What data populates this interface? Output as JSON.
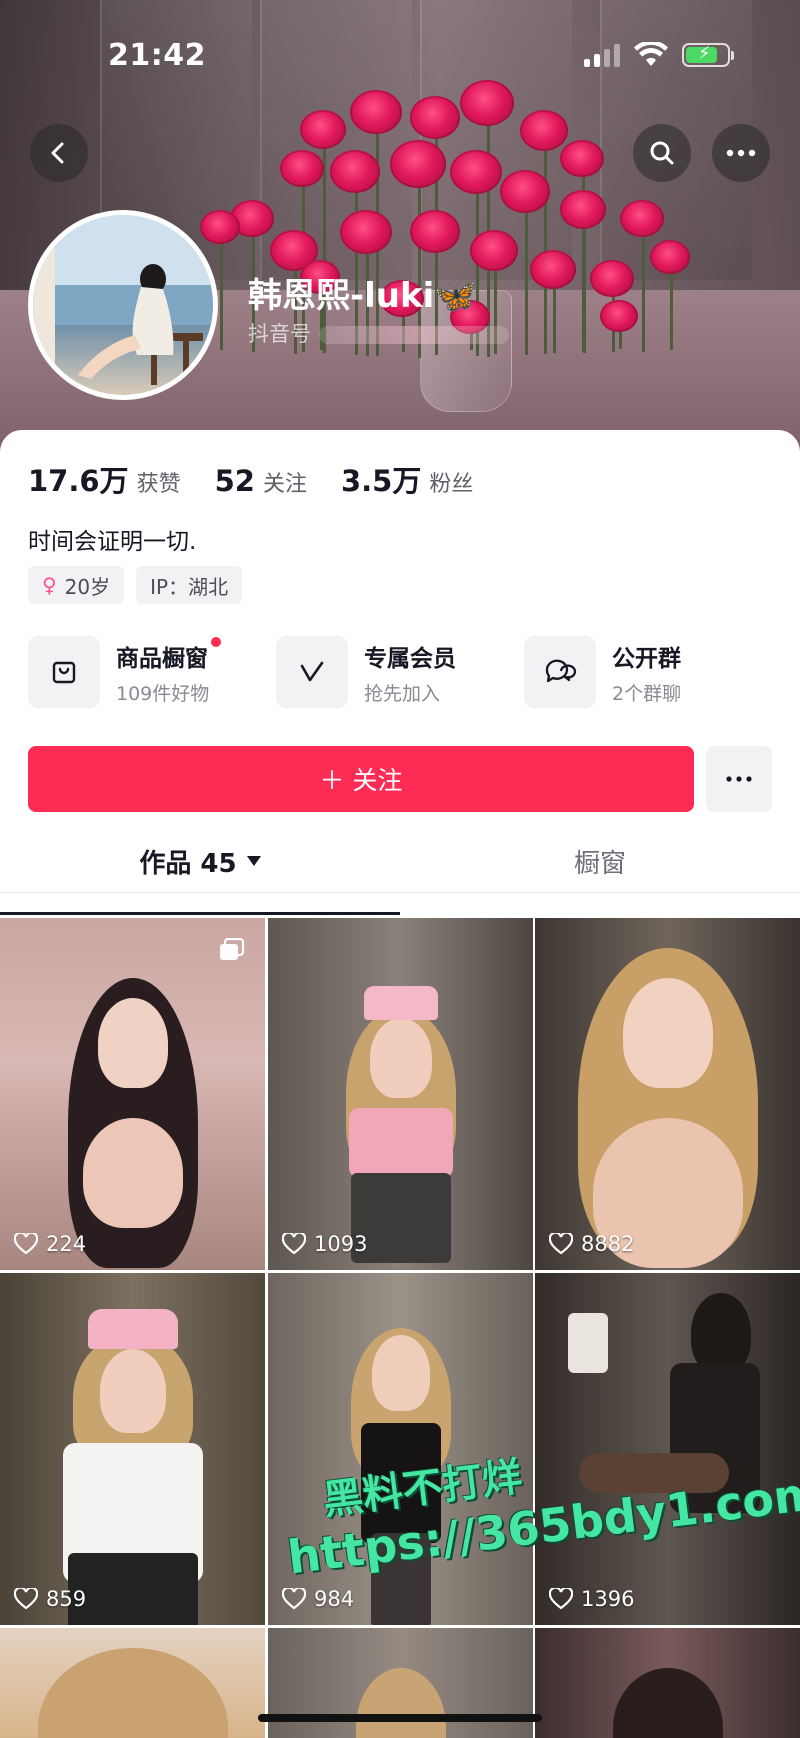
{
  "status_bar": {
    "time": "21:42"
  },
  "header": {
    "nickname": "韩恩熙-luki",
    "nickname_emoji": "🦋",
    "douyin_id_label": "抖音号"
  },
  "stats": [
    {
      "value": "17.6万",
      "label": "获赞"
    },
    {
      "value": "52",
      "label": "关注"
    },
    {
      "value": "3.5万",
      "label": "粉丝"
    }
  ],
  "bio": "时间会证明一切.",
  "tags": {
    "gender_icon": "♀",
    "age": "20岁",
    "ip": "IP：湖北"
  },
  "features": [
    {
      "title": "商品橱窗",
      "subtitle": "109件好物",
      "icon": "bag-icon",
      "has_dot": true
    },
    {
      "title": "专属会员",
      "subtitle": "抢先加入",
      "icon": "vip-v-icon",
      "has_dot": false
    },
    {
      "title": "公开群",
      "subtitle": "2个群聊",
      "icon": "chat-bubbles-icon",
      "has_dot": false
    }
  ],
  "follow_button": {
    "label": "＋ 关注"
  },
  "tabs": [
    {
      "label": "作品 45",
      "active": true
    },
    {
      "label": "橱窗",
      "active": false
    }
  ],
  "videos": [
    {
      "likes": "224",
      "multi_image": true
    },
    {
      "likes": "1093",
      "multi_image": false
    },
    {
      "likes": "8882",
      "multi_image": false
    },
    {
      "likes": "859",
      "multi_image": false
    },
    {
      "likes": "984",
      "multi_image": false
    },
    {
      "likes": "1396",
      "multi_image": false
    }
  ],
  "watermark": {
    "line1": "黑料不打烊",
    "line2": "https://365bdy1.com"
  },
  "colors": {
    "accent": "#fe2c55",
    "watermark": "#45e6a2"
  }
}
